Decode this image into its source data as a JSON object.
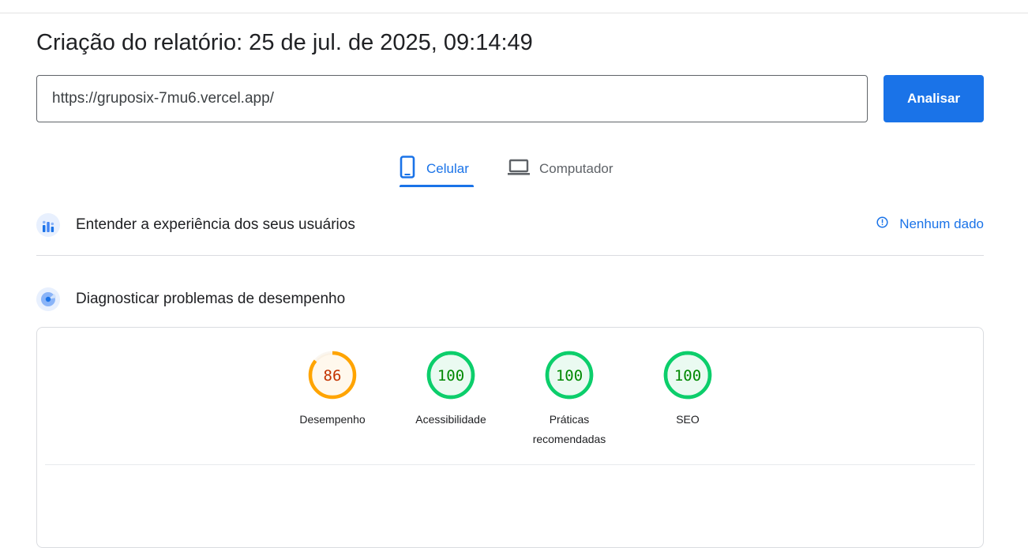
{
  "report": {
    "title": "Criação do relatório: 25 de jul. de 2025, 09:14:49"
  },
  "search": {
    "url_value": "https://gruposix-7mu6.vercel.app/",
    "analyze_label": "Analisar"
  },
  "tabs": [
    {
      "label": "Celular",
      "icon": "smartphone-icon",
      "active": true
    },
    {
      "label": "Computador",
      "icon": "laptop-icon",
      "active": false
    }
  ],
  "sections": {
    "field_data": {
      "title": "Entender a experiência dos seus usuários",
      "icon": "users-chart-icon",
      "status_label": "Nenhum dado",
      "status_icon": "info-icon"
    },
    "lab_data": {
      "title": "Diagnosticar problemas de desempenho",
      "icon": "lighthouse-icon"
    }
  },
  "scores": [
    {
      "label": "Desempenho",
      "value": "86",
      "fraction": 0.86,
      "rating": "average"
    },
    {
      "label": "Acessibilidade",
      "value": "100",
      "fraction": 1.0,
      "rating": "pass"
    },
    {
      "label": "Práticas recomendadas",
      "value": "100",
      "fraction": 1.0,
      "rating": "pass"
    },
    {
      "label": "SEO",
      "value": "100",
      "fraction": 1.0,
      "rating": "pass"
    }
  ],
  "colors": {
    "accent": "#1a73e8",
    "average": "#ffa400",
    "average_text": "#c33300",
    "average_fill": "#fff8ed",
    "pass": "#0cce6b",
    "pass_text": "#008800",
    "pass_fill": "#eafaf1"
  }
}
